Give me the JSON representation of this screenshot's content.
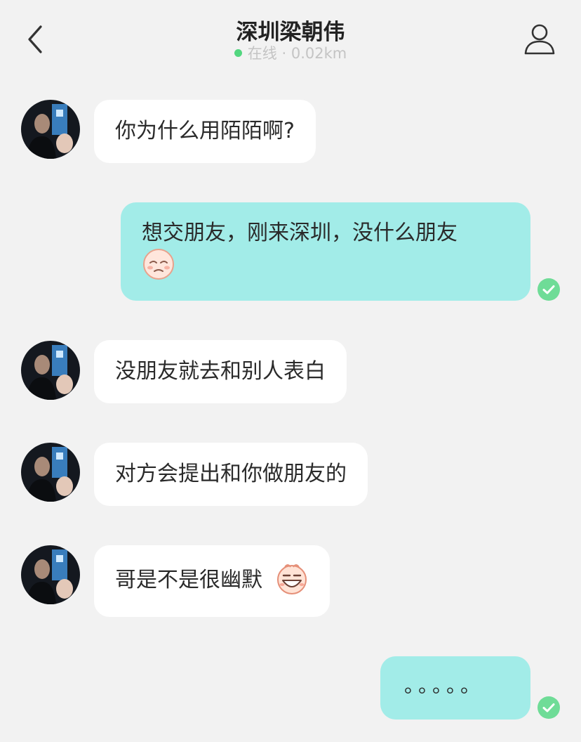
{
  "header": {
    "title": "深圳梁朝伟",
    "status": "在线",
    "separator": "·",
    "distance": "0.02km",
    "online_color": "#52d67f"
  },
  "icons": {
    "back": "chevron-left-icon",
    "profile": "user-icon",
    "read_receipt": "check-circle-icon"
  },
  "colors": {
    "background": "#f2f2f2",
    "incoming_bubble": "#ffffff",
    "outgoing_bubble": "#a2ece8",
    "read_tick": "#6fdc97"
  },
  "messages": [
    {
      "from": "them",
      "text": "你为什么用陌陌啊?"
    },
    {
      "from": "me",
      "text": "想交朋友，刚来深圳，没什么朋友",
      "emoji": "sad-face-emoji",
      "read": true
    },
    {
      "from": "them",
      "text": "没朋友就去和别人表白"
    },
    {
      "from": "them",
      "text": "对方会提出和你做朋友的"
    },
    {
      "from": "them",
      "text": "哥是不是很幽默",
      "emoji": "grinning-face-emoji"
    },
    {
      "from": "me",
      "text": "。。。。。",
      "read": true
    }
  ]
}
